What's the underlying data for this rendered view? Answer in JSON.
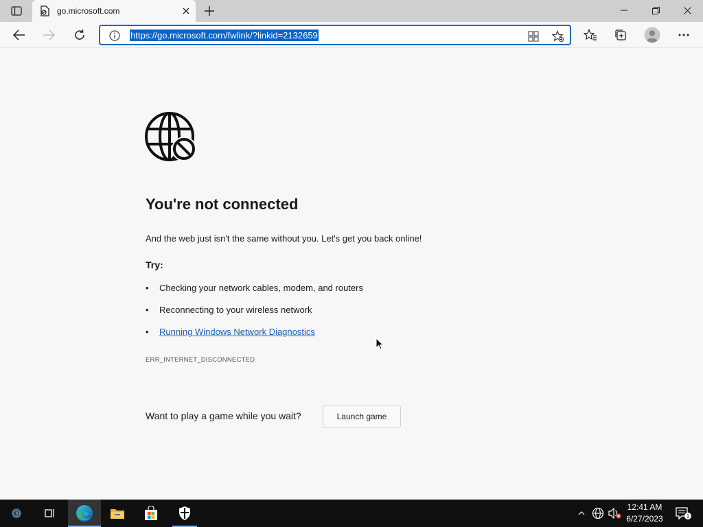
{
  "browser": {
    "tab": {
      "title": "go.microsoft.com"
    },
    "address": {
      "url": "https://go.microsoft.com/fwlink/?linkid=2132659"
    }
  },
  "page": {
    "heading": "You're not connected",
    "subtitle": "And the web just isn't the same without you. Let's get you back online!",
    "try_label": "Try:",
    "suggestions": [
      "Checking your network cables, modem, and routers",
      "Reconnecting to your wireless network",
      "Running Windows Network Diagnostics"
    ],
    "error_code": "ERR_INTERNET_DISCONNECTED",
    "game_prompt": "Want to play a game while you wait?",
    "launch_game_label": "Launch game"
  },
  "taskbar": {
    "apps": [
      "cortana-icon",
      "task-view-icon",
      "edge-icon",
      "file-explorer-icon",
      "microsoft-store-icon",
      "security-icon"
    ],
    "clock": {
      "time": "12:41 AM",
      "date": "6/27/2023"
    },
    "notification_count": "1"
  },
  "colors": {
    "accent": "#0f6cbd",
    "url_highlight": "#0a64c8",
    "link": "#1a5fb4",
    "taskbar": "#101010"
  }
}
